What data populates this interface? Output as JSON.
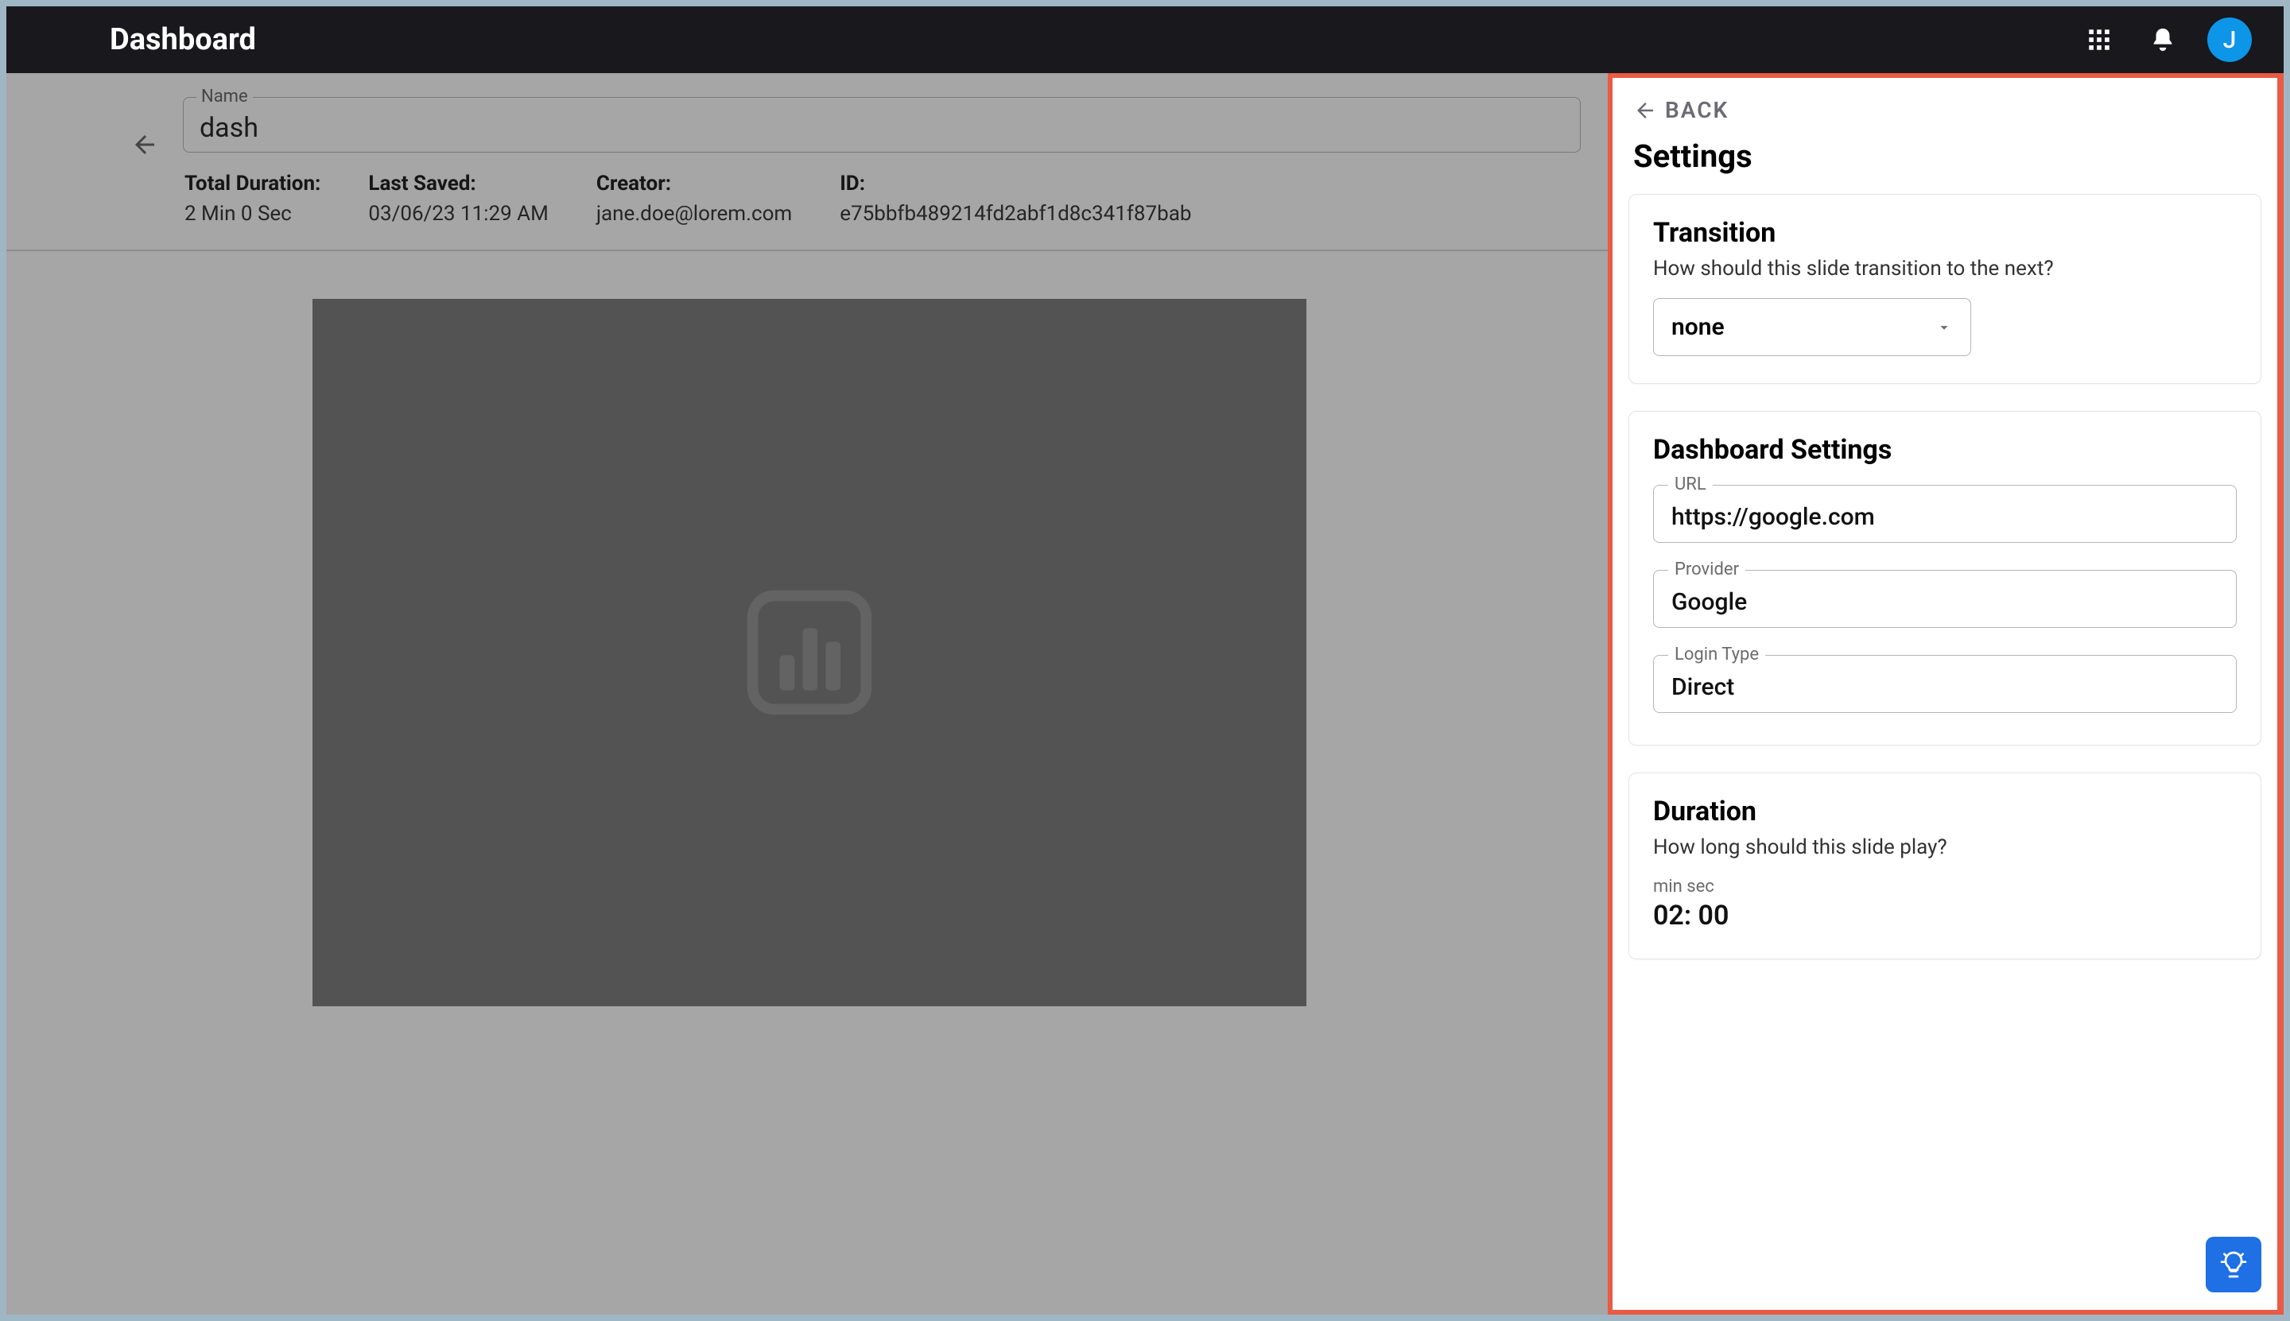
{
  "header": {
    "title": "Dashboard",
    "avatar_letter": "J"
  },
  "main": {
    "name_label": "Name",
    "name_value": "dash",
    "stats": {
      "total_duration_label": "Total Duration:",
      "total_duration_value": "2 Min 0 Sec",
      "last_saved_label": "Last Saved:",
      "last_saved_value": "03/06/23 11:29 AM",
      "creator_label": "Creator:",
      "creator_value": "jane.doe@lorem.com",
      "id_label": "ID:",
      "id_value": "e75bbfb489214fd2abf1d8c341f87bab"
    }
  },
  "panel": {
    "back_label": "BACK",
    "title": "Settings",
    "transition": {
      "heading": "Transition",
      "sub": "How should this slide transition to the next?",
      "value": "none"
    },
    "dashboard_settings": {
      "heading": "Dashboard Settings",
      "url_label": "URL",
      "url_value": "https://google.com",
      "provider_label": "Provider",
      "provider_value": "Google",
      "login_label": "Login Type",
      "login_value": "Direct"
    },
    "duration": {
      "heading": "Duration",
      "sub": "How long should this slide play?",
      "units_label": "min  sec",
      "value": "02: 00"
    }
  },
  "colors": {
    "panel_border": "#ea5a44",
    "avatar_bg": "#0d95e8",
    "fab_bg": "#1f6fe5"
  }
}
